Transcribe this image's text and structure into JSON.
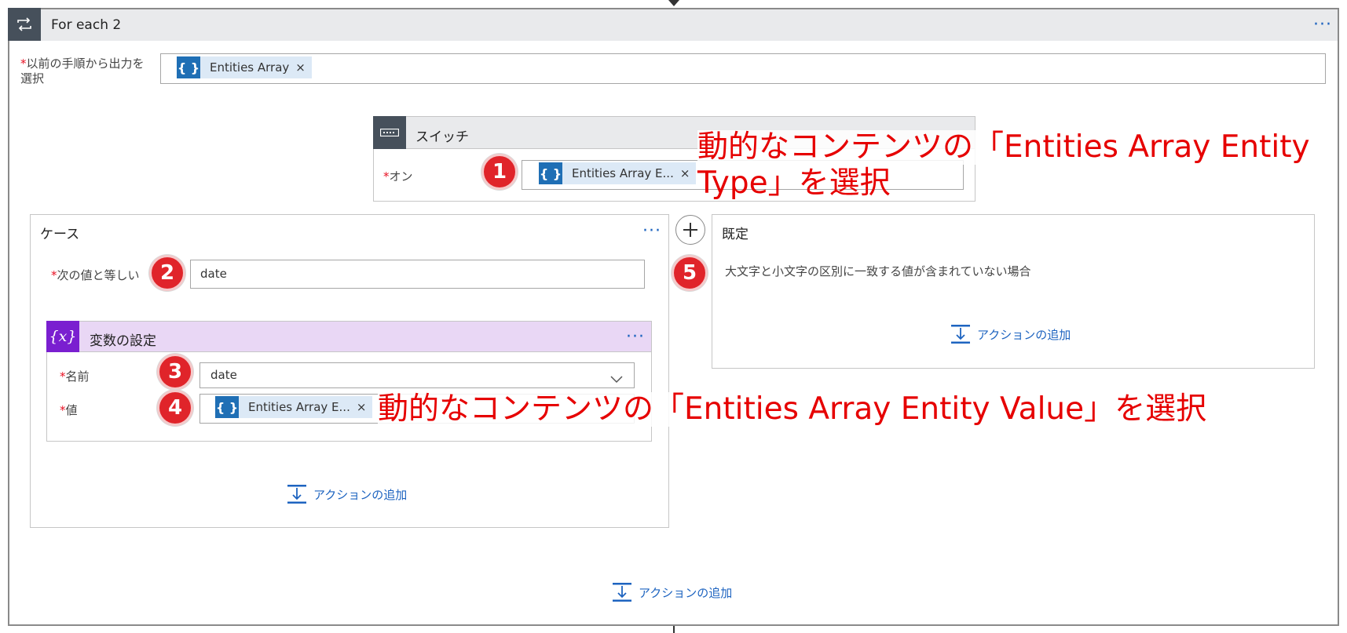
{
  "foreach": {
    "title": "For each 2",
    "select_label": "以前の手順から出力を選択",
    "select_token": "Entities Array",
    "more": "···",
    "add_action": "アクションの追加"
  },
  "switch": {
    "title": "スイッチ",
    "on_label": "オン",
    "on_token": "Entities Array E...",
    "annotation_line1": "動的なコンテンツの「Entities Array Entity",
    "annotation_line2": "Type」を選択"
  },
  "case": {
    "title": "ケース",
    "more": "···",
    "equals_label": "次の値と等しい",
    "equals_value": "date",
    "add_action": "アクションの追加",
    "set_variable": {
      "title": "変数の設定",
      "icon_text": "{x}",
      "more": "···",
      "name_label": "名前",
      "name_value": "date",
      "value_label": "値",
      "value_token": "Entities Array E...",
      "annotation": "動的なコンテンツの「Entities Array Entity Value」を選択"
    }
  },
  "default": {
    "title": "既定",
    "description": "大文字と小文字の区別に一致する値が含まれていない場合",
    "add_action": "アクションの追加"
  },
  "badges": [
    "1",
    "2",
    "3",
    "4",
    "5"
  ],
  "token_icon_text": "{ }",
  "token_remove": "×",
  "colors": {
    "accent": "#1e64c0",
    "token_icon": "#1f6fb5",
    "token_bg": "#dce9f6",
    "badge": "#e0242a",
    "annotation": "#e60000",
    "variable_header": "#e9d7f5",
    "variable_icon": "#7a1fd0",
    "header_bg": "#e9eaec",
    "header_icon_bg": "#46505b"
  }
}
